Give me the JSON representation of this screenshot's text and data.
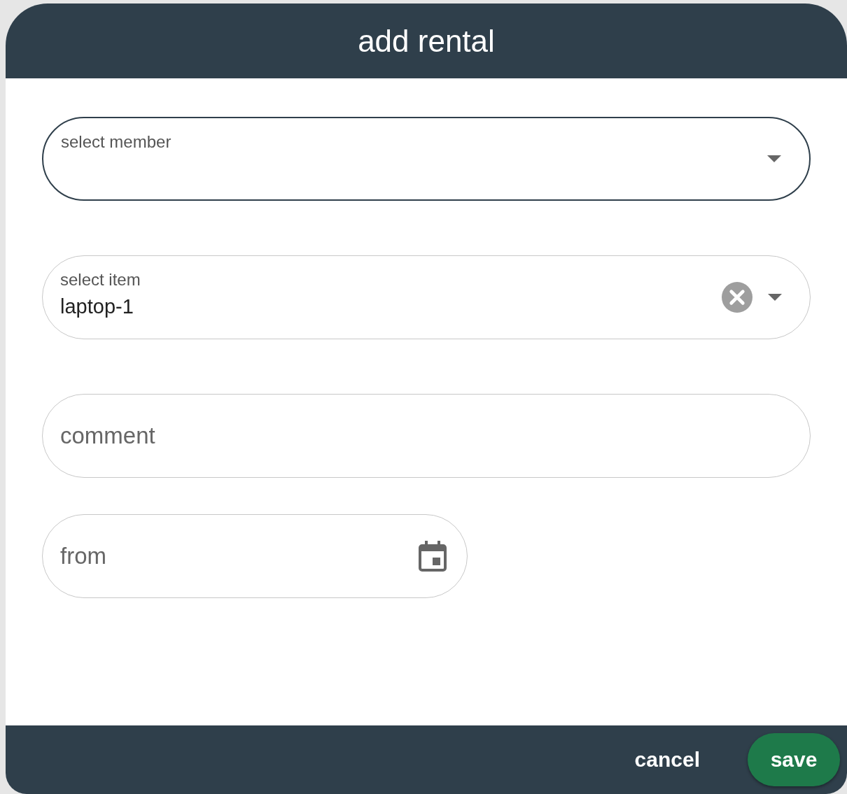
{
  "dialog": {
    "title": "add rental"
  },
  "fields": [
    {
      "kind": "select",
      "label": "select member",
      "focused": true,
      "clearable": false
    },
    {
      "kind": "select",
      "label": "select item",
      "value": "laptop-1",
      "focused": false,
      "clearable": true
    },
    {
      "kind": "text",
      "placeholder": "comment",
      "focused": false
    },
    {
      "kind": "date",
      "placeholder": "from",
      "focused": false
    }
  ],
  "buttons": [
    {
      "label": "cancel",
      "kind": "text"
    },
    {
      "label": "save",
      "kind": "filled"
    }
  ]
}
